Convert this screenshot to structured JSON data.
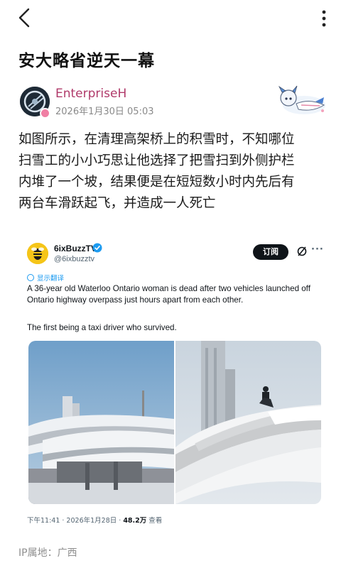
{
  "icons": {
    "back": "chevron-left-icon",
    "more": "more-vertical-icon",
    "verified": "verified-badge-icon",
    "grok": "grok-icon",
    "translate": "translate-icon"
  },
  "colors": {
    "author_name": "#b03a6a",
    "link_blue": "#1d9bf0",
    "subscribe_bg": "#0f1419"
  },
  "post": {
    "title": "安大略省逆天一幕",
    "author": "EnterpriseH",
    "time": "2026年1月30日 05:03",
    "body_lines": [
      "如图所示，在清理高架桥上的积雪时，不知哪位",
      "扫雪工的小小巧思让他选择了把雪扫到外侧护栏",
      "内堆了一个坡，结果便是在短短数小时内先后有",
      "两台车滑跃起飞，并造成一人死亡"
    ]
  },
  "tweet": {
    "display_name": "6ixBuzzTV",
    "handle": "@6ixbuzztv",
    "subscribe_label": "订阅",
    "more_label": "···",
    "translate_label": "显示翻译",
    "text_main": "A 36-year old Waterloo Ontario woman is dead after two vehicles launched off Ontario highway overpass just hours apart from each other.",
    "text_second": "The first being a taxi driver who survived.",
    "meta_time": "下午11:41 · 2026年1月28日 · ",
    "meta_views": "48.2万",
    "meta_views_label": " 查看"
  },
  "footer": {
    "ip_location": "IP属地：广西"
  }
}
